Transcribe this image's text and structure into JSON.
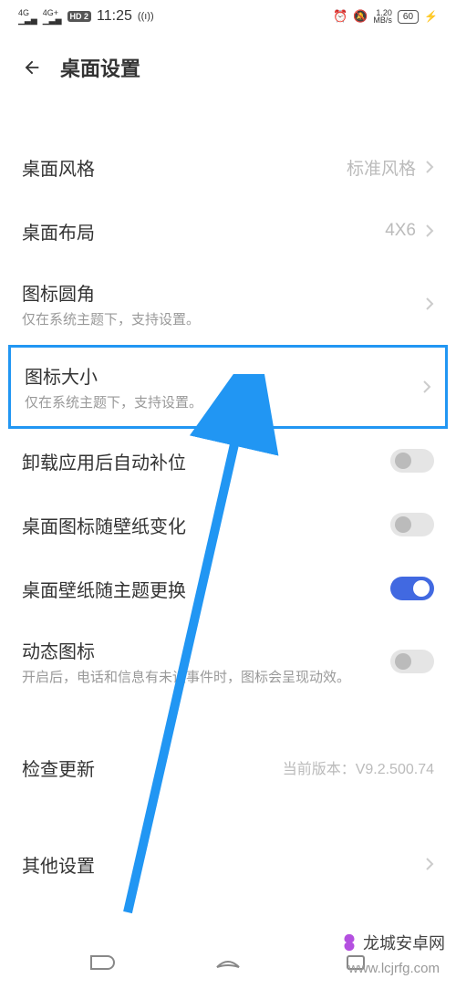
{
  "status_bar": {
    "signal1": "4G",
    "signal2": "4G+",
    "hd": "HD 2",
    "time": "11:25",
    "speed_val": "1.20",
    "speed_unit": "MB/s",
    "battery": "60"
  },
  "header": {
    "title": "桌面设置"
  },
  "rows": {
    "style": {
      "label": "桌面风格",
      "value": "标准风格"
    },
    "layout": {
      "label": "桌面布局",
      "value": "4X6"
    },
    "icon_radius": {
      "label": "图标圆角",
      "desc": "仅在系统主题下，支持设置。"
    },
    "icon_size": {
      "label": "图标大小",
      "desc": "仅在系统主题下，支持设置。"
    },
    "auto_fill": {
      "label": "卸载应用后自动补位"
    },
    "icon_wallpaper": {
      "label": "桌面图标随壁纸变化"
    },
    "wallpaper_theme": {
      "label": "桌面壁纸随主题更换"
    },
    "dynamic_icon": {
      "label": "动态图标",
      "desc": "开启后，电话和信息有未读事件时，图标会呈现动效。"
    },
    "update": {
      "label": "检查更新",
      "value": "当前版本：V9.2.500.74"
    },
    "other": {
      "label": "其他设置"
    }
  },
  "watermark": {
    "text": "龙城安卓网",
    "url": "www.lcjrfg.com"
  }
}
